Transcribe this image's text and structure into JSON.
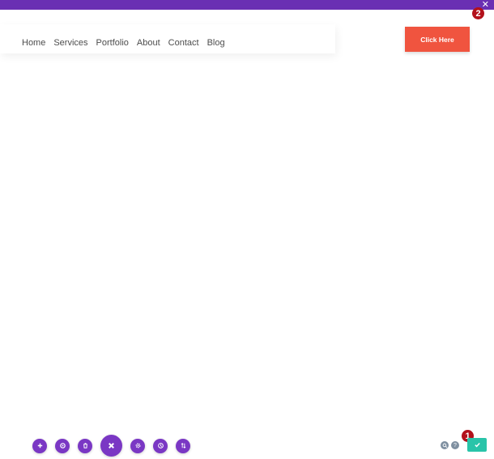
{
  "topbar": {
    "color": "#6a2fb3",
    "close_icon": "close-icon"
  },
  "nav": {
    "items": [
      {
        "label": "Home"
      },
      {
        "label": "Services"
      },
      {
        "label": "Portfolio"
      },
      {
        "label": "About"
      },
      {
        "label": "Contact"
      },
      {
        "label": "Blog"
      }
    ]
  },
  "cta": {
    "label": "Click Here",
    "color": "#f0543f"
  },
  "badges": {
    "first": "1",
    "second": "2"
  },
  "toolbar": {
    "buttons": [
      {
        "icon": "plus-icon"
      },
      {
        "icon": "power-icon"
      },
      {
        "icon": "trash-icon"
      },
      {
        "icon": "close-icon"
      },
      {
        "icon": "gear-icon"
      },
      {
        "icon": "history-icon"
      },
      {
        "icon": "sort-icon"
      }
    ],
    "color": "#7a37c4"
  },
  "bottom_right": {
    "search_icon": "search-icon",
    "help_icon": "help-icon",
    "save_icon": "check-icon",
    "save_color": "#29c4a9"
  }
}
